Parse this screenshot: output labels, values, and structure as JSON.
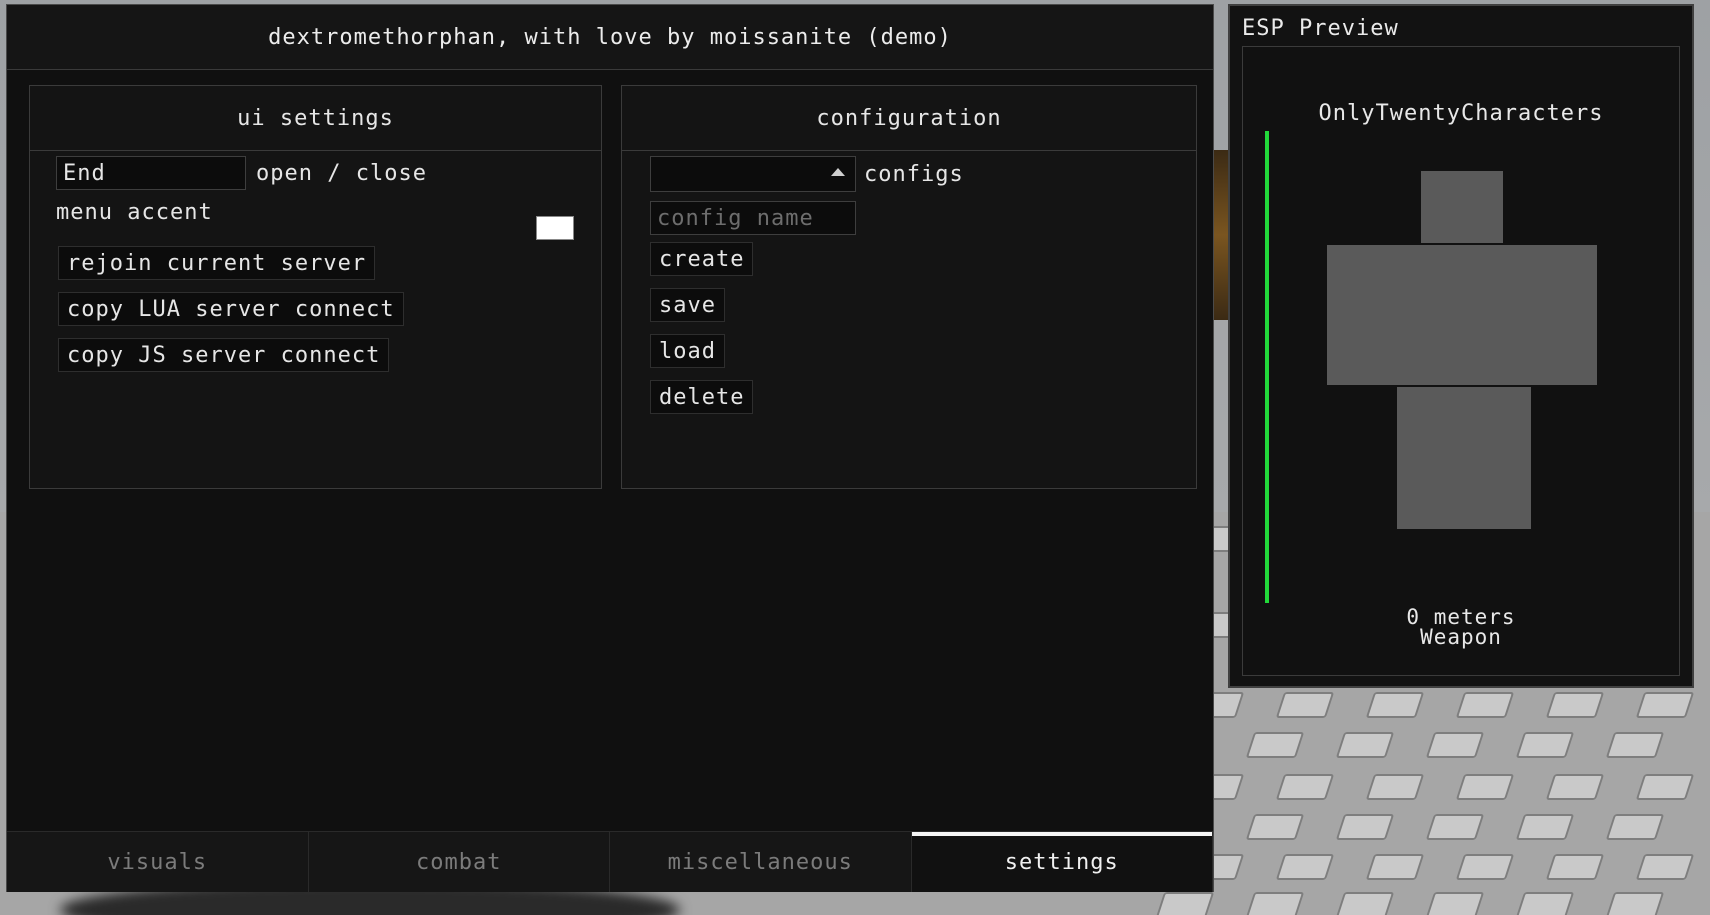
{
  "main_window": {
    "title": "dextromethorphan, with love by moissanite (demo)"
  },
  "ui_settings": {
    "header": "ui settings",
    "keybind_value": "End",
    "keybind_label": "open / close",
    "menu_accent_label": "menu accent",
    "menu_accent_color": "#ffffff",
    "buttons": {
      "rejoin": "rejoin current server",
      "copy_lua": "copy LUA server connect",
      "copy_js": "copy JS server connect"
    }
  },
  "configuration": {
    "header": "configuration",
    "configs_label": "configs",
    "configs_selected": "",
    "config_name_placeholder": "config name",
    "buttons": {
      "create": "create",
      "save": "save",
      "load": "load",
      "delete": "delete"
    }
  },
  "tabs": [
    {
      "label": "visuals",
      "active": false
    },
    {
      "label": "combat",
      "active": false
    },
    {
      "label": "miscellaneous",
      "active": false
    },
    {
      "label": "settings",
      "active": true
    }
  ],
  "esp_preview": {
    "title": "ESP Preview",
    "player_name": "OnlyTwentyCharacters",
    "distance": "0 meters",
    "weapon": "Weapon",
    "health_fraction": 1.0,
    "health_color": "#22d93a"
  }
}
